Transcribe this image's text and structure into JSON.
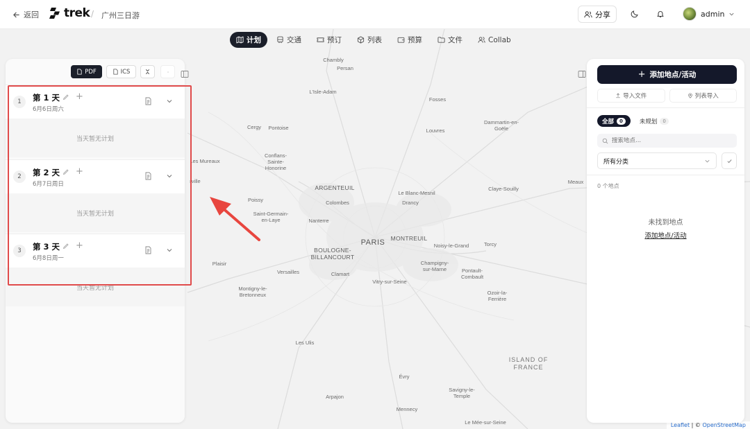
{
  "header": {
    "back_label": "返回",
    "logo_text": "trek",
    "trip_title": "广州三日游",
    "share_label": "分享",
    "user_name": "admin"
  },
  "tabs": [
    {
      "label": "计划",
      "icon": "map-icon",
      "active": true
    },
    {
      "label": "交通",
      "icon": "train-icon",
      "active": false
    },
    {
      "label": "预订",
      "icon": "ticket-icon",
      "active": false
    },
    {
      "label": "列表",
      "icon": "package-icon",
      "active": false
    },
    {
      "label": "预算",
      "icon": "wallet-icon",
      "active": false
    },
    {
      "label": "文件",
      "icon": "folder-icon",
      "active": false
    },
    {
      "label": "Collab",
      "icon": "users-icon",
      "active": false
    }
  ],
  "left_panel": {
    "pdf_label": "PDF",
    "ics_label": "ICS",
    "days": [
      {
        "num": "1",
        "title": "第 1 天",
        "date": "6月6日周六",
        "empty_text": "当天暂无计划"
      },
      {
        "num": "2",
        "title": "第 2 天",
        "date": "6月7日周日",
        "empty_text": "当天暂无计划"
      },
      {
        "num": "3",
        "title": "第 3 天",
        "date": "6月8日周一",
        "empty_text": "当天暂无计划"
      }
    ]
  },
  "right_panel": {
    "add_place_label": "添加地点/活动",
    "import_file_label": "导入文件",
    "import_list_label": "列表导入",
    "filter_all_label": "全部",
    "filter_all_count": "0",
    "filter_unplanned_label": "未规划",
    "filter_unplanned_count": "0",
    "search_placeholder": "搜索地点...",
    "category_value": "所有分类",
    "count_label": "0 个地点",
    "empty_title": "未找到地点",
    "empty_link": "添加地点/活动"
  },
  "map": {
    "labels": {
      "paris": "PARIS",
      "chambly": "Chambly",
      "persan": "Persan",
      "lisle": "L'Isle-Adam",
      "fosses": "Fosses",
      "louvres": "Louvres",
      "dammartin": "Dammartin-en-\nGoële",
      "cergy": "Cergy",
      "pontoise": "Pontoise",
      "conflans": "Conflans-\nSainte-\nHonorine",
      "mureaux": "Les Mureaux",
      "rville": "rville",
      "argenteuil": "ARGENTEUIL",
      "blancmesnil": "Le Blanc-Mesnil",
      "drancy": "Drancy",
      "claye": "Claye-Souilly",
      "meaux": "Meaux",
      "poissy": "Poissy",
      "colombes": "Colombes",
      "stgermain": "Saint-Germain-\nen-Laye",
      "nanterre": "Nanterre",
      "montreuil": "MONTREUIL",
      "noisy": "Noisy-le-Grand",
      "torcy": "Torcy",
      "boulogne": "BOULOGNE-\nBILLANCOURT",
      "plaisir": "Plaisir",
      "versailles": "Versailles",
      "clamart": "Clamart",
      "champigny": "Champigny-\nsur-Marne",
      "pontault": "Pontault-\nCombault",
      "vitry": "Vitry-sur-Seine",
      "ozoir": "Ozoir-la-\nFerrière",
      "montigny": "Montigny-le-\nBretonneux",
      "lesulis": "Les Ulis",
      "iledefrance": "ISLAND OF\nFRANCE",
      "evry": "Évry",
      "savigny": "Savigny-le-\nTemple",
      "arpajon": "Arpajon",
      "mennecy": "Mennecy",
      "lemee": "Le Mée-sur-Seine"
    },
    "attribution_leaflet": "Leaflet",
    "attribution_sep": " | © ",
    "attribution_osm": "OpenStreetMap"
  }
}
